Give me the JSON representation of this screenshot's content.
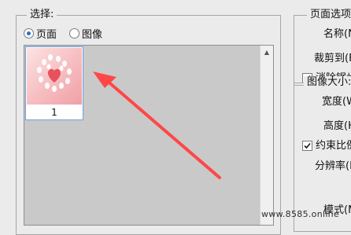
{
  "selection": {
    "legend": "选择:",
    "radio_page": "页面",
    "radio_image": "图像",
    "selected": "page"
  },
  "thumbnails": [
    {
      "caption": "1"
    }
  ],
  "page_options": {
    "legend": "页面选项",
    "name_label": "名称(N",
    "crop_label": "裁剪到(F",
    "anti_alias_label": "消除锯齿",
    "anti_alias_checked": true
  },
  "image_size": {
    "legend": "图像大小:",
    "width_label": "宽度(W",
    "height_label": "高度(H",
    "constrain_label": "约束比例",
    "constrain_checked": true,
    "resolution_label": "分辨率(R",
    "mode_label": "模式(M"
  },
  "watermark": "www.8585.online",
  "colors": {
    "arrow": "#ff4747",
    "thumb_border": "#6e9fd6",
    "list_bg": "#c9c9c9",
    "radio_dot": "#2b6fc8"
  }
}
